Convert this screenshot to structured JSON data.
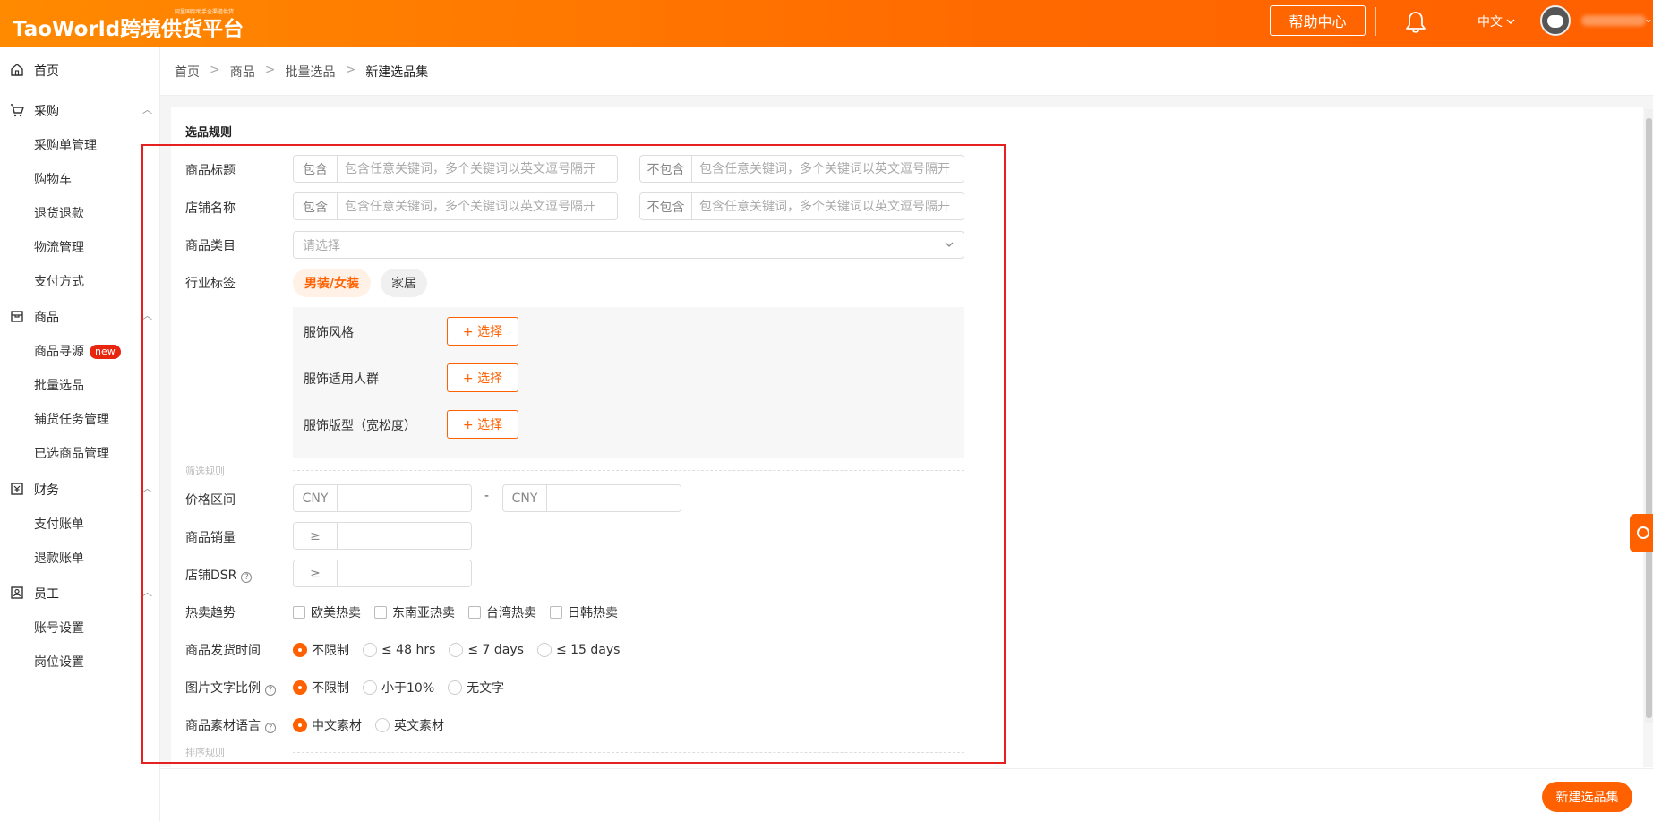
{
  "header": {
    "logo": "TaoWorld跨境供货平台",
    "tagline": "阿里国际助手全渠道供货",
    "help_label": "帮助中心",
    "language": "中文"
  },
  "colors": {
    "brand": "#ff6000",
    "highlight": "#e52020"
  },
  "sidebar": {
    "groups": [
      {
        "label": "首页",
        "icon": "home-icon"
      },
      {
        "label": "采购",
        "icon": "cart-icon",
        "items": [
          "采购单管理",
          "购物车",
          "退货退款",
          "物流管理",
          "支付方式"
        ]
      },
      {
        "label": "商品",
        "icon": "goods-icon",
        "items": [
          "商品寻源",
          "批量选品",
          "铺货任务管理",
          "已选商品管理"
        ],
        "badge": "new"
      },
      {
        "label": "财务",
        "icon": "finance-icon",
        "items": [
          "支付账单",
          "退款账单"
        ]
      },
      {
        "label": "员工",
        "icon": "staff-icon",
        "items": [
          "账号设置",
          "岗位设置"
        ]
      }
    ]
  },
  "breadcrumb": [
    "首页",
    "商品",
    "批量选品",
    "新建选品集"
  ],
  "form": {
    "section_title": "选品规则",
    "labels": {
      "title": "商品标题",
      "shop": "店铺名称",
      "category": "商品类目",
      "industry": "行业标签",
      "price": "价格区间",
      "sales": "商品销量",
      "dsr": "店铺DSR",
      "trend": "热卖趋势",
      "ship": "商品发货时间",
      "img_ratio": "图片文字比例",
      "lang": "商品素材语言"
    },
    "include": "包含",
    "exclude": "不包含",
    "keyword_placeholder": "包含任意关键词，多个关键词以英文逗号隔开",
    "category_placeholder": "请选择",
    "tags": [
      "男装/女装",
      "家居"
    ],
    "sub_attributes": [
      "服饰风格",
      "服饰适用人群",
      "服饰版型（宽松度）"
    ],
    "choose_label": "+ 选择",
    "filter_rules": "筛选规则",
    "sort_rules": "排序规则",
    "currency": "CNY",
    "range_dash": "-",
    "gte": "≥",
    "trends": [
      "欧美热卖",
      "东南亚热卖",
      "台湾热卖",
      "日韩热卖"
    ],
    "ship_options": [
      "不限制",
      "≤ 48 hrs",
      "≤ 7 days",
      "≤ 15 days"
    ],
    "img_options": [
      "不限制",
      "小于10%",
      "无文字"
    ],
    "lang_options": [
      "中文素材",
      "英文素材"
    ],
    "help_mark": "?"
  },
  "footer": {
    "create_label": "新建选品集"
  }
}
